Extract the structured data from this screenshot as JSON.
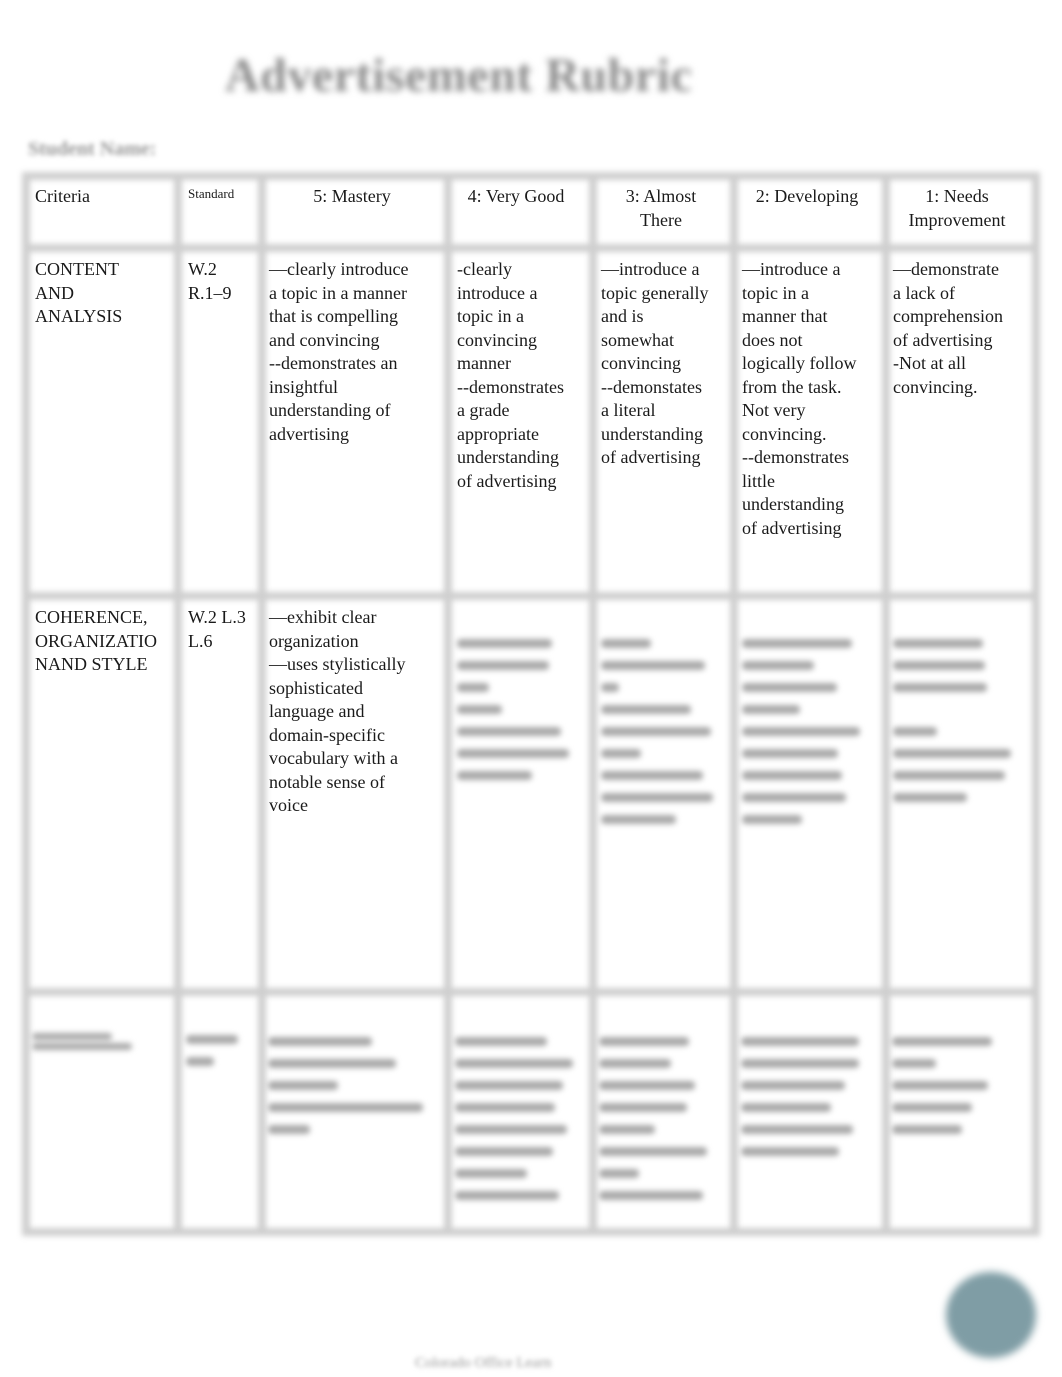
{
  "document": {
    "title": "Advertisement Rubric",
    "student_name_label": "Student Name:",
    "footer_text": "Colorado Office Learn"
  },
  "rubric": {
    "headers": {
      "criteria": "Criteria",
      "standard": "Standard",
      "level5": "5: Mastery",
      "level4": "4: Very Good",
      "level3": "3: Almost\nThere",
      "level2": "2: Developing",
      "level1": "1: Needs\nImprovement"
    },
    "rows": [
      {
        "criteria": "CONTENT\nAND\nANALYSIS",
        "standard": "W.2\nR.1–9",
        "level5": "—clearly introduce\na topic in a manner\nthat is compelling\nand convincing\n--demonstrates an\ninsightful\nunderstanding of\nadvertising",
        "level4": " -clearly\nintroduce a\ntopic in a\nconvincing\nmanner\n--demonstrates\na grade\nappropriate\nunderstanding\nof advertising",
        "level3": "—introduce a\ntopic generally\nand is\nsomewhat\nconvincing\n--demonstates\na literal\nunderstanding\nof advertising",
        "level2": "—introduce a\ntopic in a\nmanner that\ndoes not\nlogically follow\nfrom the task.\nNot very\nconvincing.\n--demonstrates\nlittle\nunderstanding\nof advertising",
        "level1": "—demonstrate\na lack of\ncomprehension\nof advertising\n-Not at all\nconvincing."
      },
      {
        "criteria": "COHERENCE,\nORGANIZATIO\nNAND STYLE",
        "standard": "W.2 L.3\nL.6",
        "level5": "—exhibit clear\norganization\n—uses stylistically\nsophisticated\nlanguage and\ndomain-specific\nvocabulary with a\nnotable sense of\nvoice",
        "level4": "",
        "level3": "",
        "level2": "",
        "level1": ""
      },
      {
        "criteria": "",
        "standard": "",
        "level5": "",
        "level4": "",
        "level3": "",
        "level2": "",
        "level1": ""
      }
    ]
  }
}
